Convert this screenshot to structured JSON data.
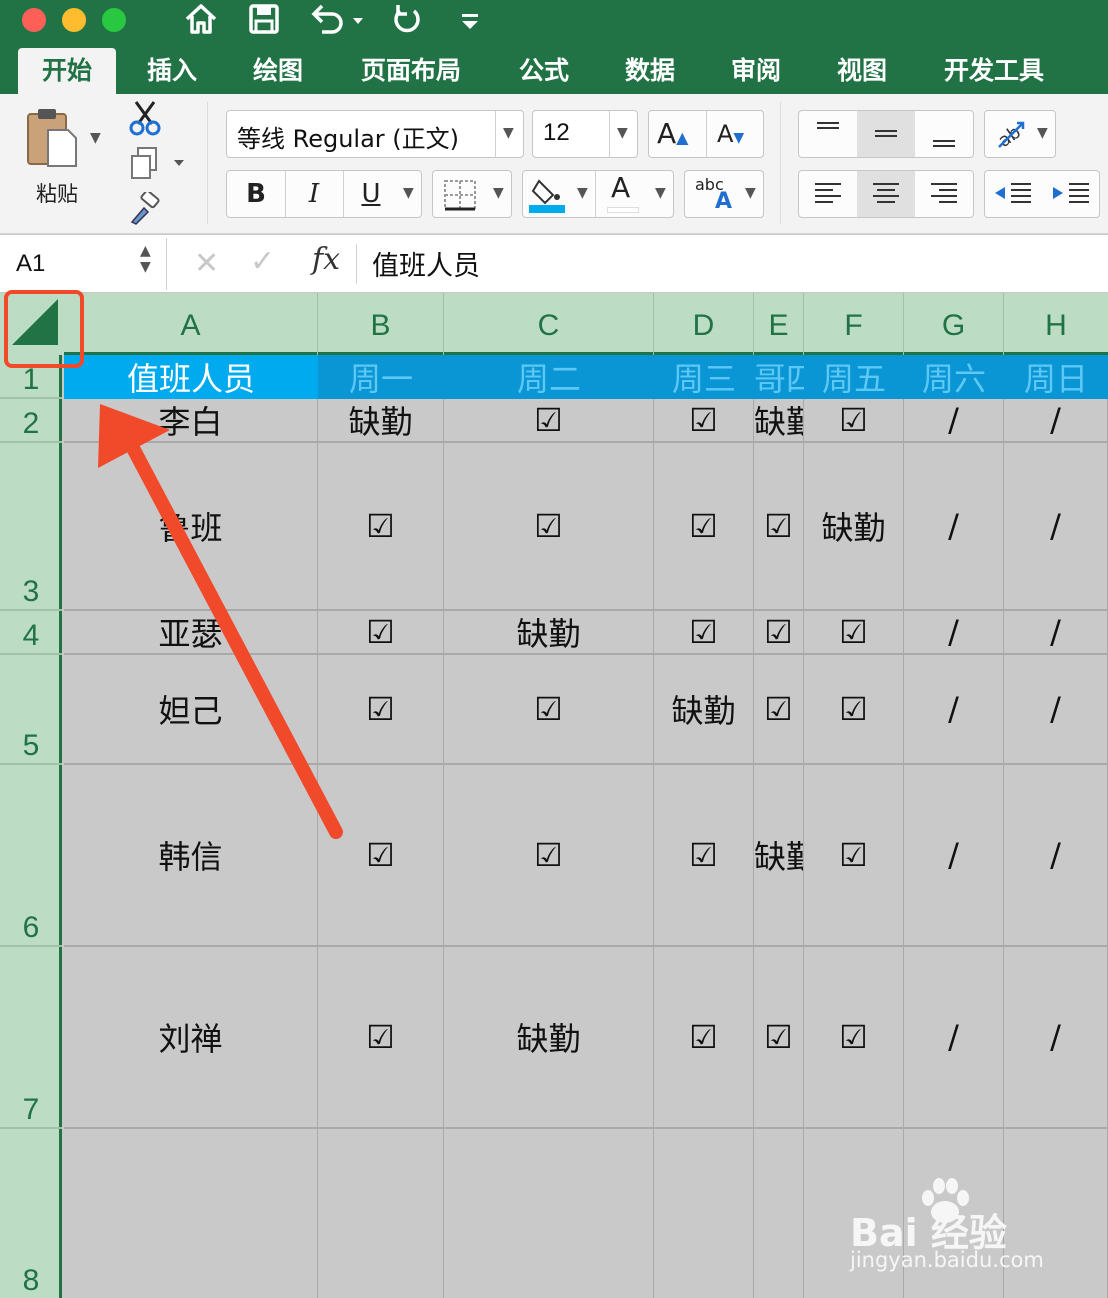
{
  "titlebar": {
    "home_icon": "home-icon",
    "save_icon": "save-icon",
    "undo_icon": "undo-icon",
    "redo_icon": "redo-icon",
    "customize_icon": "customize-toolbar-icon"
  },
  "tabs": [
    "开始",
    "插入",
    "绘图",
    "页面布局",
    "公式",
    "数据",
    "审阅",
    "视图",
    "开发工具"
  ],
  "ribbon": {
    "paste_label": "粘贴",
    "font_name": "等线 Regular (正文)",
    "font_size": "12",
    "grow_font": "A",
    "shrink_font": "A",
    "bold": "B",
    "italic": "I",
    "underline": "U",
    "font_color": "A",
    "text_style_top": "abc",
    "text_style_bottom": "A"
  },
  "formula_bar": {
    "name_box": "A1",
    "fx": "fx",
    "content": "值班人员"
  },
  "columns": [
    "A",
    "B",
    "C",
    "D",
    "E",
    "F",
    "G",
    "H"
  ],
  "rows": [
    "1",
    "2",
    "3",
    "4",
    "5",
    "6",
    "7",
    "8"
  ],
  "header_row": [
    "值班人员",
    "周一",
    "周二",
    "周三",
    "哥四",
    "周五",
    "周六",
    "周日"
  ],
  "data_rows": [
    [
      "李白",
      "缺勤",
      "☑",
      "☑",
      "缺勤",
      "☑",
      "/",
      "/"
    ],
    [
      "鲁班",
      "☑",
      "☑",
      "☑",
      "☑",
      "缺勤",
      "/",
      "/"
    ],
    [
      "亚瑟",
      "☑",
      "缺勤",
      "☑",
      "☑",
      "☑",
      "/",
      "/"
    ],
    [
      "妲己",
      "☑",
      "☑",
      "缺勤",
      "☑",
      "☑",
      "/",
      "/"
    ],
    [
      "韩信",
      "☑",
      "☑",
      "☑",
      "缺勤",
      "☑",
      "/",
      "/"
    ],
    [
      "刘禅",
      "☑",
      "缺勤",
      "☑",
      "☑",
      "☑",
      "/",
      "/"
    ]
  ],
  "colors": {
    "excel_green": "#217346",
    "header_blue": "#00aaee",
    "annotation_red": "#f04a2b"
  },
  "watermark": {
    "brand": "Bai 经验",
    "url": "jingyan.baidu.com"
  }
}
